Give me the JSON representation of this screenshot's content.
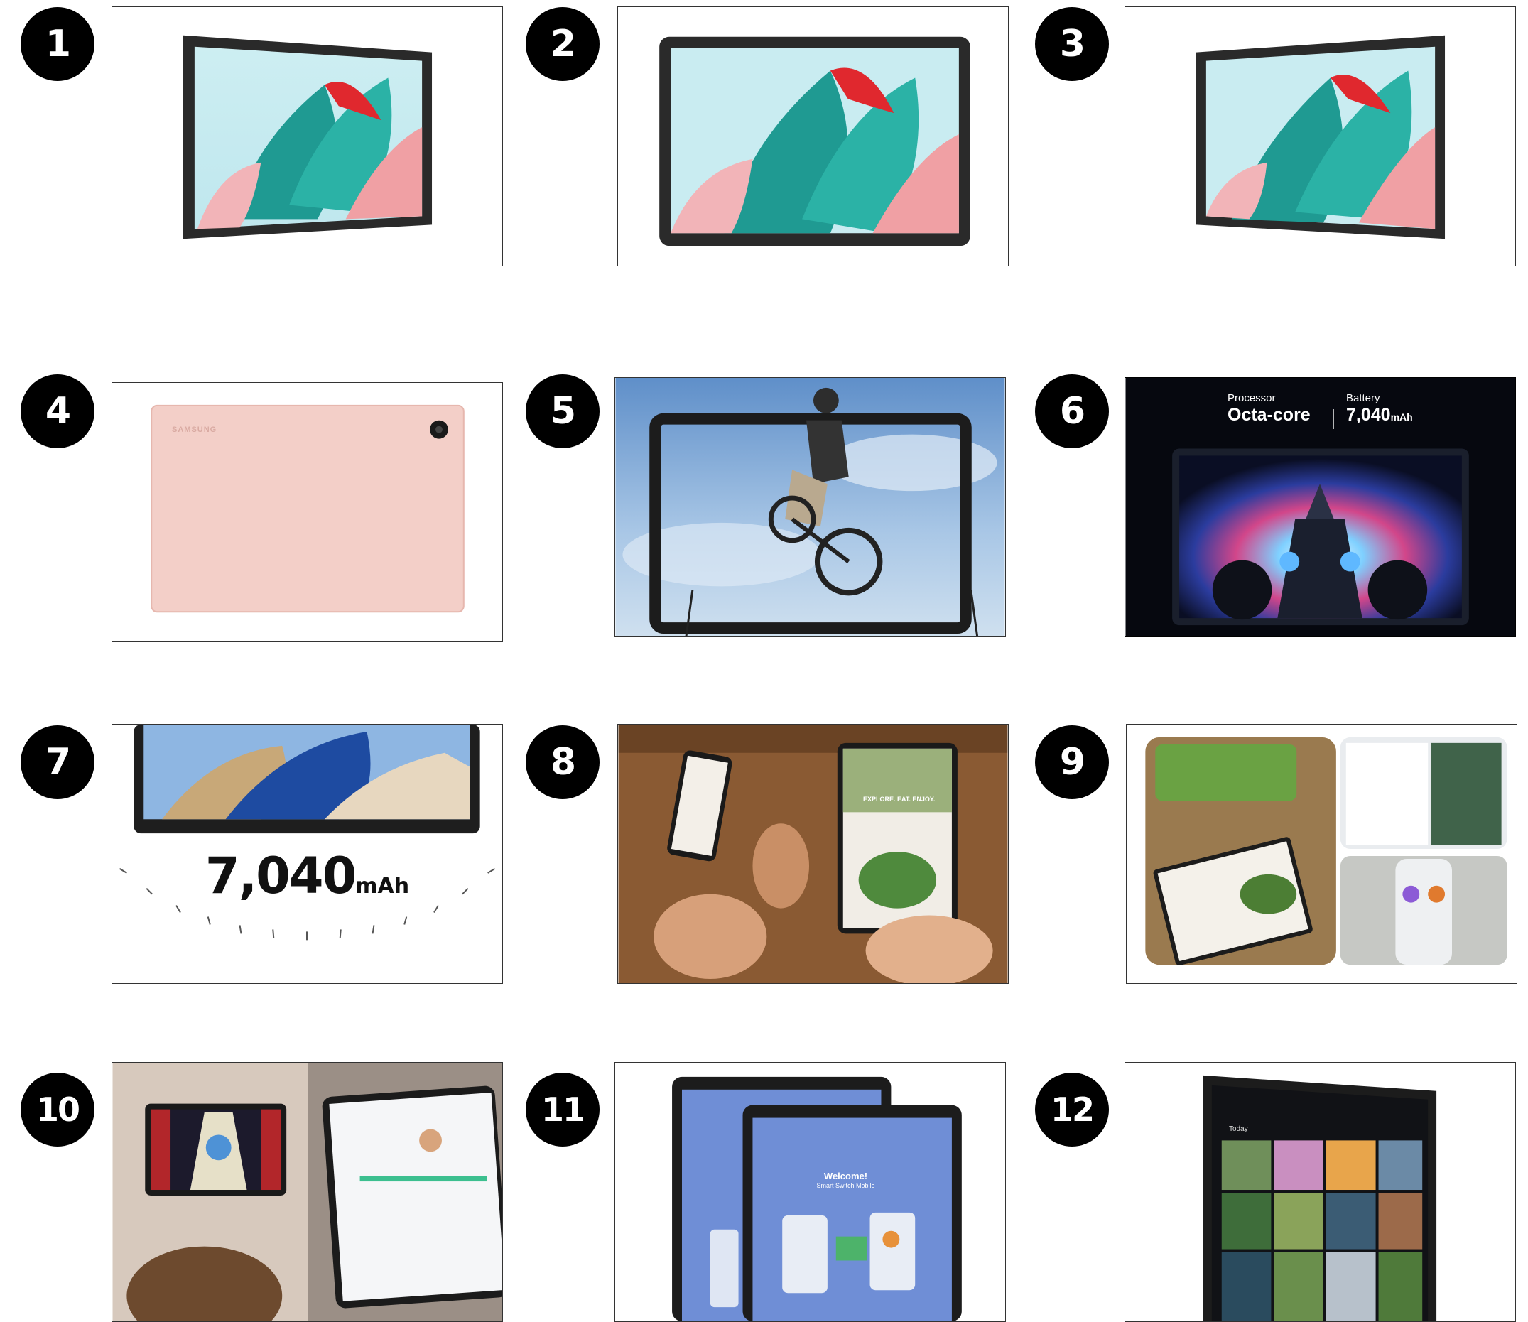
{
  "badges": [
    "1",
    "2",
    "3",
    "4",
    "5",
    "6",
    "7",
    "8",
    "9",
    "10",
    "11",
    "12"
  ],
  "tiles": [
    {
      "subject": "tablet-front-angle-left"
    },
    {
      "subject": "tablet-front"
    },
    {
      "subject": "tablet-front-angle-right"
    },
    {
      "subject": "tablet-back-pink-gold",
      "back_logo": "SAMSUNG"
    },
    {
      "subject": "bmx-rider-jumping-out-of-screen"
    },
    {
      "subject": "racing-car-on-screen",
      "specs": {
        "processor_label": "Processor",
        "processor_value": "Octa-core",
        "battery_label": "Battery",
        "battery_value": "7,040",
        "battery_unit": "mAh"
      }
    },
    {
      "subject": "battery-dial",
      "battery_value": "7,040",
      "battery_unit": "mAh"
    },
    {
      "subject": "people-sharing-recipe-on-phone-and-tablet",
      "screen_text": "EXPLORE. EAT. ENJOY."
    },
    {
      "subject": "multitasking-recipe-note-collage"
    },
    {
      "subject": "kids-tablet-and-parental-controls"
    },
    {
      "subject": "smart-switch-welcome-screens",
      "welcome_title": "Welcome!",
      "welcome_subtitle": "Smart Switch Mobile"
    },
    {
      "subject": "gallery-app-on-tablet",
      "gallery_heading": "Today"
    }
  ],
  "colors": {
    "badge_bg": "#000000",
    "badge_fg": "#ffffff",
    "tile_border": "#333333"
  }
}
